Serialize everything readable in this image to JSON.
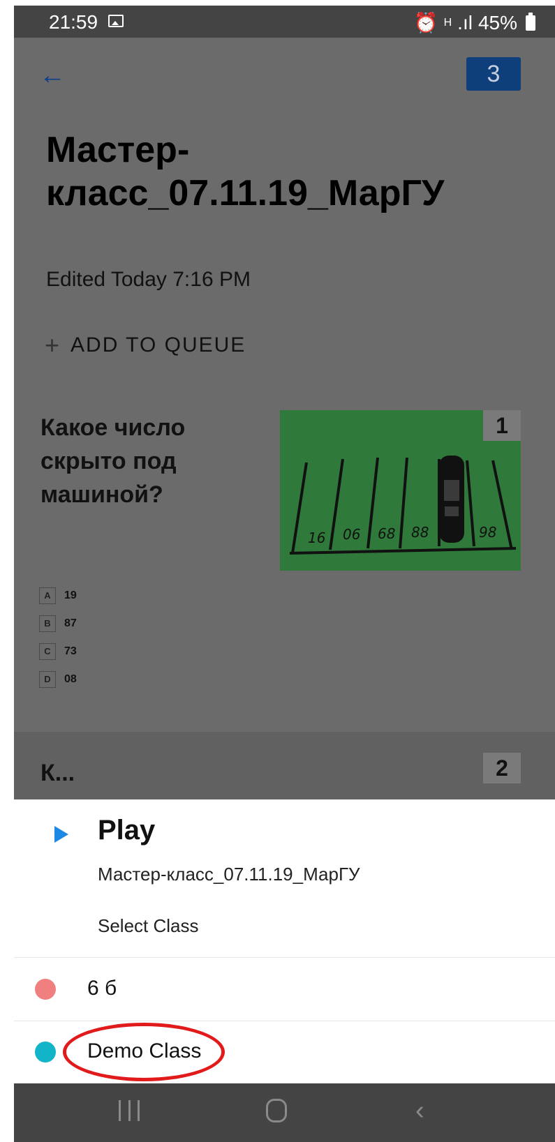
{
  "status_bar": {
    "time": "21:59",
    "network": "H",
    "signal": ".ıl",
    "battery": "45%",
    "icons": [
      "image-icon",
      "alarm-icon",
      "data-icon",
      "signal-icon",
      "battery-icon"
    ]
  },
  "header": {
    "back_icon": "arrow-left-icon",
    "count_badge": "3",
    "title": "Мастер-класс_07.11.19_МарГУ",
    "edited": "Edited Today 7:16 PM",
    "add_to_queue": "ADD TO QUEUE",
    "add_to_queue_icon": "+"
  },
  "questions": [
    {
      "number": "1",
      "text": "Какое число скрыто под машиной?",
      "image_labels": [
        "16",
        "06",
        "68",
        "88",
        "98"
      ],
      "answers": [
        {
          "letter": "A",
          "value": "19"
        },
        {
          "letter": "B",
          "value": "87"
        },
        {
          "letter": "C",
          "value": "73"
        },
        {
          "letter": "D",
          "value": "08"
        }
      ]
    },
    {
      "number": "2",
      "text": "К..."
    }
  ],
  "sheet": {
    "play_label": "Play",
    "quiz_name": "Мастер-класс_07.11.19_МарГУ",
    "select_class_label": "Select Class",
    "classes": [
      {
        "name": "6 б",
        "color": "#f08080"
      },
      {
        "name": "Demo Class",
        "color": "#12b5c8"
      }
    ]
  },
  "colors": {
    "accent": "#1e88e5",
    "badge": "#0f3f7a",
    "highlight": "#e11b1b"
  }
}
